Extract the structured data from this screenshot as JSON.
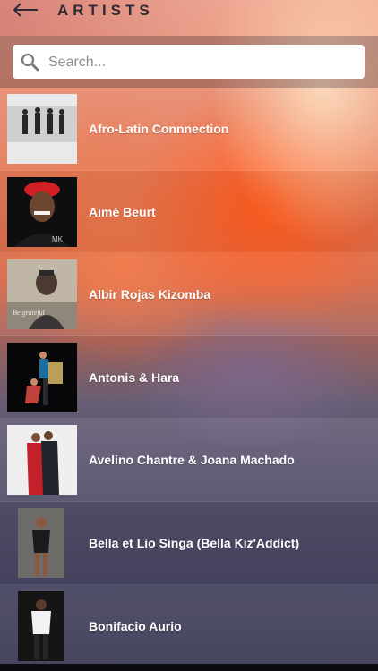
{
  "header": {
    "title": "ARTISTS",
    "back_icon": "arrow-left-icon"
  },
  "search": {
    "placeholder": "Search...",
    "icon": "search-icon"
  },
  "artists": [
    {
      "name": "Afro-Latin Connnection"
    },
    {
      "name": "Aimé Beurt"
    },
    {
      "name": "Albir Rojas Kizomba"
    },
    {
      "name": "Antonis & Hara"
    },
    {
      "name": "Avelino Chantre & Joana Machado"
    },
    {
      "name": "Bella et Lio Singa (Bella Kiz'Addict)"
    },
    {
      "name": "Bonifacio Aurio"
    }
  ],
  "colors": {
    "title": "#2b2a35",
    "row_text": "#ffffff",
    "search_bg": "#ffffff"
  }
}
